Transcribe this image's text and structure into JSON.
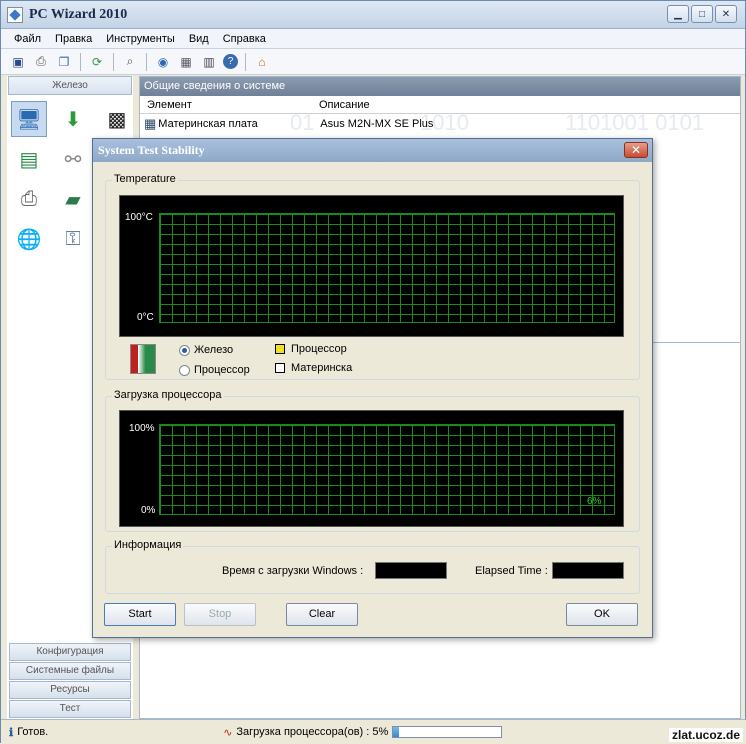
{
  "window": {
    "title": "PC Wizard 2010"
  },
  "menu": [
    "Файл",
    "Правка",
    "Инструменты",
    "Вид",
    "Справка"
  ],
  "left_panel": {
    "header": "Железо",
    "bottom_buttons": [
      "Конфигурация",
      "Системные файлы",
      "Ресурсы",
      "Тест"
    ]
  },
  "right_panel": {
    "header": "Общие сведения о системе",
    "col_element": "Элемент",
    "col_description": "Описание",
    "row1_element": "Материнская плата",
    "row1_description": "Asus M2N-MX SE Plus"
  },
  "dialog": {
    "title": "System Test Stability",
    "temperature": {
      "label": "Temperature",
      "max_label": "100°C",
      "min_label": "0°C",
      "radio_hardware": "Железо",
      "radio_cpu": "Процессор",
      "legend_cpu": "Процессор",
      "legend_mb": "Материнска",
      "legend_cpu_color": "#f0e020"
    },
    "cpu_load": {
      "label": "Загрузка процессора",
      "max_label": "100%",
      "min_label": "0%",
      "value_text": "6%"
    },
    "info": {
      "label": "Информация",
      "uptime_label": "Время с загрузки Windows :",
      "elapsed_label": "Elapsed Time :"
    },
    "buttons": {
      "start": "Start",
      "stop": "Stop",
      "clear": "Clear",
      "ok": "OK"
    }
  },
  "status": {
    "ready": "Готов.",
    "cpu_load": "Загрузка процессора(ов) : 5%",
    "cpu_load_fraction": 0.05
  },
  "watermark": "zlat.ucoz.de"
}
